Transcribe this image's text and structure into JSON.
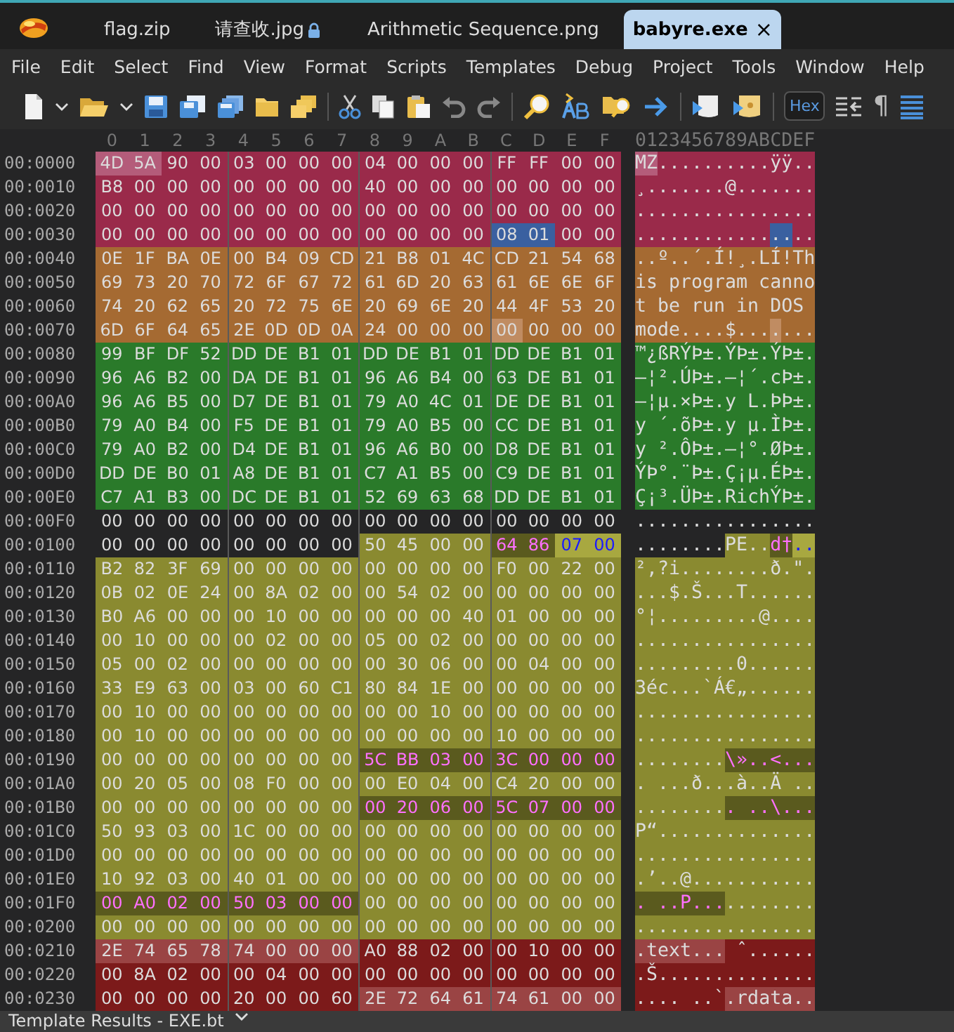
{
  "tabs": [
    {
      "label": "flag.zip",
      "selected": false,
      "locked": false
    },
    {
      "label": "请查收.jpg",
      "selected": false,
      "locked": true
    },
    {
      "label": "Arithmetic Sequence.png",
      "selected": false,
      "locked": false
    },
    {
      "label": "babyre.exe",
      "selected": true,
      "locked": false,
      "close": "×"
    }
  ],
  "menu": [
    "File",
    "Edit",
    "Select",
    "Find",
    "View",
    "Format",
    "Scripts",
    "Templates",
    "Debug",
    "Project",
    "Tools",
    "Window",
    "Help"
  ],
  "toolbar": {
    "hex_toggle": {
      "label": "Hex",
      "selected": true
    },
    "pilcrow": "¶"
  },
  "columns": [
    "0",
    "1",
    "2",
    "3",
    "4",
    "5",
    "6",
    "7",
    "8",
    "9",
    "A",
    "B",
    "C",
    "D",
    "E",
    "F"
  ],
  "ascii_header": "0123456789ABCDEF",
  "rows": [
    {
      "address": "00:0000",
      "segments": [
        {
          "hex": "4D 5A",
          "ascii": "MZ",
          "color": "#b45c7a"
        },
        {
          "hex": "90 00 03 00 00 00 04 00 00 00 FF FF 00 00",
          "ascii": "..........ÿÿ..",
          "color": "#9a2a4a"
        }
      ]
    },
    {
      "address": "00:0010",
      "segments": [
        {
          "hex": "B8 00 00 00 00 00 00 00 40 00 00 00 00 00 00 00",
          "ascii": "¸.......@.......",
          "color": "#9a2a4a"
        }
      ]
    },
    {
      "address": "00:0020",
      "segments": [
        {
          "hex": "00 00 00 00 00 00 00 00 00 00 00 00 00 00 00 00",
          "ascii": "................",
          "color": "#9a2a4a"
        }
      ]
    },
    {
      "address": "00:0030",
      "segments": [
        {
          "hex": "00 00 00 00 00 00 00 00 00 00 00 00",
          "ascii": "............",
          "color": "#9a2a4a"
        },
        {
          "hex": "08 01",
          "ascii": "..",
          "color": "#3a60a0"
        },
        {
          "hex": "00 00",
          "ascii": "..",
          "color": "#9a2a4a"
        }
      ]
    },
    {
      "address": "00:0040",
      "segments": [
        {
          "hex": "0E 1F BA 0E 00 B4 09 CD 21 B8 01 4C CD 21 54 68",
          "ascii": "..º..´.Í!¸.LÍ!Th",
          "color": "#a56a32"
        }
      ]
    },
    {
      "address": "00:0050",
      "segments": [
        {
          "hex": "69 73 20 70 72 6F 67 72 61 6D 20 63 61 6E 6E 6F",
          "ascii": "is program canno",
          "color": "#a56a32"
        }
      ]
    },
    {
      "address": "00:0060",
      "segments": [
        {
          "hex": "74 20 62 65 20 72 75 6E 20 69 6E 20 44 4F 53 20",
          "ascii": "t be run in DOS ",
          "color": "#a56a32"
        }
      ]
    },
    {
      "address": "00:0070",
      "segments": [
        {
          "hex": "6D 6F 64 65 2E 0D 0D 0A 24 00 00 00",
          "ascii": "mode....$...",
          "color": "#a56a32"
        },
        {
          "hex": "00",
          "ascii": ".",
          "color": "#c08c62"
        },
        {
          "hex": "00 00 00",
          "ascii": "...",
          "color": "#a56a32"
        }
      ]
    },
    {
      "address": "00:0080",
      "segments": [
        {
          "hex": "99 BF DF 52 DD DE B1 01 DD DE B1 01 DD DE B1 01",
          "ascii": "™¿ßRÝÞ±.ÝÞ±.ÝÞ±.",
          "color": "#2a7a2a"
        }
      ]
    },
    {
      "address": "00:0090",
      "segments": [
        {
          "hex": "96 A6 B2 00 DA DE B1 01 96 A6 B4 00 63 DE B1 01",
          "ascii": "–¦².ÚÞ±.–¦´.cÞ±.",
          "color": "#2a7a2a"
        }
      ]
    },
    {
      "address": "00:00A0",
      "segments": [
        {
          "hex": "96 A6 B5 00 D7 DE B1 01 79 A0 4C 01 DE DE B1 01",
          "ascii": "–¦µ.×Þ±.y L.ÞÞ±.",
          "color": "#2a7a2a"
        }
      ]
    },
    {
      "address": "00:00B0",
      "segments": [
        {
          "hex": "79 A0 B4 00 F5 DE B1 01 79 A0 B5 00 CC DE B1 01",
          "ascii": "y ´.õÞ±.y µ.ÌÞ±.",
          "color": "#2a7a2a"
        }
      ]
    },
    {
      "address": "00:00C0",
      "segments": [
        {
          "hex": "79 A0 B2 00 D4 DE B1 01 96 A6 B0 00 D8 DE B1 01",
          "ascii": "y ².ÔÞ±.–¦°.ØÞ±.",
          "color": "#2a7a2a"
        }
      ]
    },
    {
      "address": "00:00D0",
      "segments": [
        {
          "hex": "DD DE B0 01 A8 DE B1 01 C7 A1 B5 00 C9 DE B1 01",
          "ascii": "ÝÞ°.¨Þ±.Ç¡µ.ÉÞ±.",
          "color": "#2a7a2a"
        }
      ]
    },
    {
      "address": "00:00E0",
      "segments": [
        {
          "hex": "C7 A1 B3 00 DC DE B1 01 52 69 63 68 DD DE B1 01",
          "ascii": "Ç¡³.ÜÞ±.RichÝÞ±.",
          "color": "#2a7a2a"
        }
      ]
    },
    {
      "address": "00:00F0",
      "segments": [
        {
          "hex": "00 00 00 00 00 00 00 00 00 00 00 00 00 00 00 00",
          "ascii": "................"
        }
      ]
    },
    {
      "address": "00:0100",
      "segments": [
        {
          "hex": "00 00 00 00 00 00 00 00",
          "ascii": "........"
        },
        {
          "hex": "50 45 00 00",
          "ascii": "PE..",
          "color": "#8a8a30"
        },
        {
          "hex": "64 86",
          "ascii": "d†",
          "color": "#5a5a1e",
          "kind": "field"
        },
        {
          "hex": "07 00",
          "ascii": "..",
          "color": "#a8a840",
          "kind": "flag"
        }
      ]
    },
    {
      "address": "00:0110",
      "segments": [
        {
          "hex": "B2 82 3F 69 00 00 00 00 00 00 00 00 F0 00 22 00",
          "ascii": "²‚?i........ð.\".",
          "color": "#8a8a30"
        }
      ]
    },
    {
      "address": "00:0120",
      "segments": [
        {
          "hex": "0B 02 0E 24 00 8A 02 00 00 54 02 00 00 00 00 00",
          "ascii": "...$.Š...T......",
          "color": "#8a8a30"
        }
      ]
    },
    {
      "address": "00:0130",
      "segments": [
        {
          "hex": "B0 A6 00 00 00 10 00 00 00 00 00 40 01 00 00 00",
          "ascii": "°¦.........@....",
          "color": "#8a8a30"
        }
      ]
    },
    {
      "address": "00:0140",
      "segments": [
        {
          "hex": "00 10 00 00 00 02 00 00 05 00 02 00 00 00 00 00",
          "ascii": "................",
          "color": "#8a8a30"
        }
      ]
    },
    {
      "address": "00:0150",
      "segments": [
        {
          "hex": "05 00 02 00 00 00 00 00 00 30 06 00 00 04 00 00",
          "ascii": ".........0......",
          "color": "#8a8a30"
        }
      ]
    },
    {
      "address": "00:0160",
      "segments": [
        {
          "hex": "33 E9 63 00 03 00 60 C1 80 84 1E 00 00 00 00 00",
          "ascii": "3éc...`Á€„......",
          "color": "#8a8a30"
        }
      ]
    },
    {
      "address": "00:0170",
      "segments": [
        {
          "hex": "00 10 00 00 00 00 00 00 00 00 10 00 00 00 00 00",
          "ascii": "................",
          "color": "#8a8a30"
        }
      ]
    },
    {
      "address": "00:0180",
      "segments": [
        {
          "hex": "00 10 00 00 00 00 00 00 00 00 00 00 10 00 00 00",
          "ascii": "................",
          "color": "#8a8a30"
        }
      ]
    },
    {
      "address": "00:0190",
      "segments": [
        {
          "hex": "00 00 00 00 00 00 00 00",
          "ascii": "........",
          "color": "#8a8a30"
        },
        {
          "hex": "5C BB 03 00 3C 00 00 00",
          "ascii": "\\»..<...",
          "color": "#5a5a1e",
          "kind": "field"
        }
      ]
    },
    {
      "address": "00:01A0",
      "segments": [
        {
          "hex": "00 20 05 00 08 F0 00 00 00 E0 04 00 C4 20 00 00",
          "ascii": ". ...ð...à..Ä ..",
          "color": "#8a8a30"
        }
      ]
    },
    {
      "address": "00:01B0",
      "segments": [
        {
          "hex": "00 00 00 00 00 00 00 00",
          "ascii": "........",
          "color": "#8a8a30"
        },
        {
          "hex": "00 20 06 00 5C 07 00 00",
          "ascii": ". ..\\...",
          "color": "#5a5a1e",
          "kind": "field"
        }
      ]
    },
    {
      "address": "00:01C0",
      "segments": [
        {
          "hex": "50 93 03 00 1C 00 00 00 00 00 00 00 00 00 00 00",
          "ascii": "P“..............",
          "color": "#8a8a30"
        }
      ]
    },
    {
      "address": "00:01D0",
      "segments": [
        {
          "hex": "00 00 00 00 00 00 00 00 00 00 00 00 00 00 00 00",
          "ascii": "................",
          "color": "#8a8a30"
        }
      ]
    },
    {
      "address": "00:01E0",
      "segments": [
        {
          "hex": "10 92 03 00 40 01 00 00 00 00 00 00 00 00 00 00",
          "ascii": ".’..@...........",
          "color": "#8a8a30"
        }
      ]
    },
    {
      "address": "00:01F0",
      "segments": [
        {
          "hex": "00 A0 02 00 50 03 00 00",
          "ascii": ". ..P...",
          "color": "#5a5a1e",
          "kind": "field"
        },
        {
          "hex": "00 00 00 00 00 00 00 00",
          "ascii": "........",
          "color": "#8a8a30"
        }
      ]
    },
    {
      "address": "00:0200",
      "segments": [
        {
          "hex": "00 00 00 00 00 00 00 00 00 00 00 00 00 00 00 00",
          "ascii": "................",
          "color": "#8a8a30"
        }
      ]
    },
    {
      "address": "00:0210",
      "segments": [
        {
          "hex": "2E 74 65 78 74 00 00 00",
          "ascii": ".text...",
          "color": "#9a4444"
        },
        {
          "hex": "A0 88 02 00 00 10 00 00",
          "ascii": " ˆ......",
          "color": "#7c1a1a"
        }
      ]
    },
    {
      "address": "00:0220",
      "segments": [
        {
          "hex": "00 8A 02 00 00 04 00 00 00 00 00 00 00 00 00 00",
          "ascii": ".Š..............",
          "color": "#7c1a1a"
        }
      ]
    },
    {
      "address": "00:0230",
      "segments": [
        {
          "hex": "00 00 00 00 20 00 00 60",
          "ascii": ".... ..`",
          "color": "#7c1a1a"
        },
        {
          "hex": "2E 72 64 61 74 61 00 00",
          "ascii": ".rdata..",
          "color": "#9a4444"
        }
      ]
    }
  ],
  "bottom_panel": {
    "title": "Template Results - EXE.bt"
  }
}
